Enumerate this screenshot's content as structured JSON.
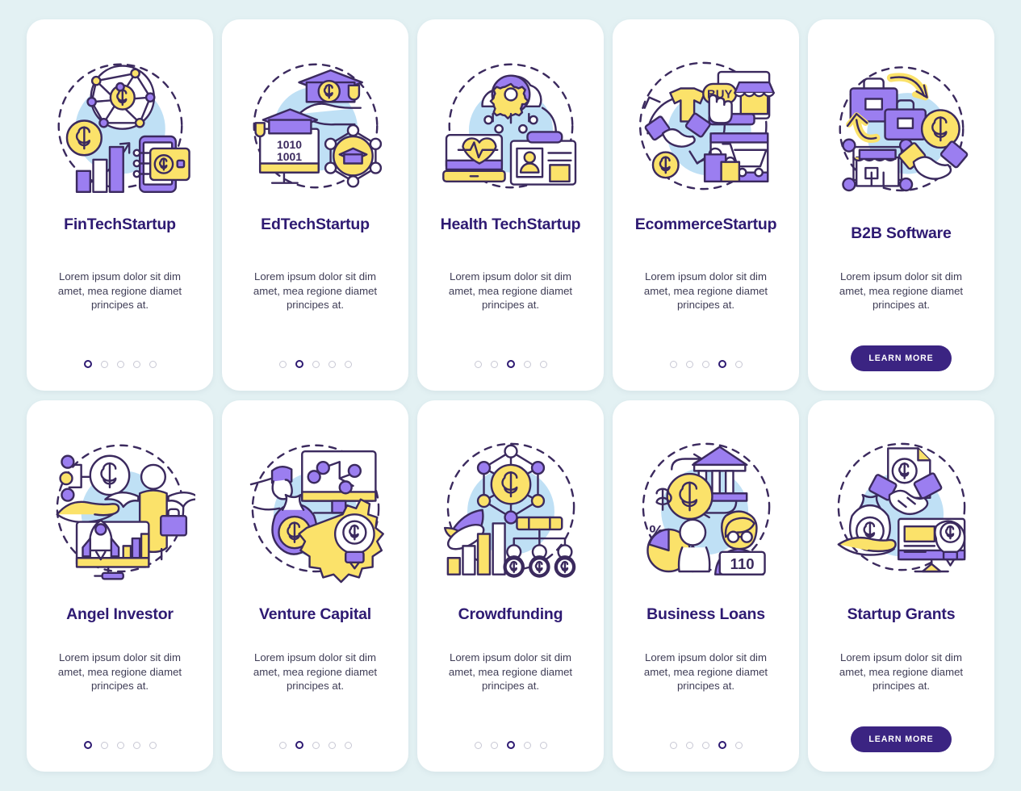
{
  "page": {
    "background_color": "#e3f1f3",
    "card_background": "#ffffff",
    "title_color": "#2e1a72",
    "body_color": "#3f3d56",
    "accent_purple": "#9b7ef0",
    "accent_yellow": "#fbe26a",
    "accent_blue": "#bfe0f5",
    "stroke_color": "#3b2a5e",
    "cta_color": "#3b2482",
    "dot_inactive_color": "#c8c8d4",
    "lorem": "Lorem ipsum dolor sit dim amet, mea regione diamet principes at."
  },
  "cards": [
    {
      "id": "fintech-startup",
      "title": "FinTech Startup",
      "title_lines": [
        "FinTech",
        "Startup"
      ],
      "description": "Lorem ipsum dolor sit dim amet, mea regione diamet principes at.",
      "footer_type": "dots",
      "dots_total": 5,
      "dots_active_index": 0,
      "illustration": "fintech-illustration",
      "illustration_labels": []
    },
    {
      "id": "edtech-startup",
      "title": "EdTech Startup",
      "title_lines": [
        "EdTech",
        "Startup"
      ],
      "description": "Lorem ipsum dolor sit dim amet, mea regione diamet principes at.",
      "footer_type": "dots",
      "dots_total": 5,
      "dots_active_index": 1,
      "illustration": "edtech-illustration",
      "illustration_labels": [
        "1010",
        "1001"
      ]
    },
    {
      "id": "health-tech-startup",
      "title": "Health Tech Startup",
      "title_lines": [
        "Health Tech",
        "Startup"
      ],
      "description": "Lorem ipsum dolor sit dim amet, mea regione diamet principes at.",
      "footer_type": "dots",
      "dots_total": 5,
      "dots_active_index": 2,
      "illustration": "healthtech-illustration",
      "illustration_labels": []
    },
    {
      "id": "ecommerce-startup",
      "title": "Ecommerce Startup",
      "title_lines": [
        "Ecommerce",
        "Startup"
      ],
      "description": "Lorem ipsum dolor sit dim amet, mea regione diamet principes at.",
      "footer_type": "dots",
      "dots_total": 5,
      "dots_active_index": 3,
      "illustration": "ecommerce-illustration",
      "illustration_labels": [
        "BUY"
      ]
    },
    {
      "id": "b2b-software",
      "title": "B2B Software",
      "title_lines": [
        "B2B Software"
      ],
      "description": "Lorem ipsum dolor sit dim amet, mea regione diamet principes at.",
      "footer_type": "button",
      "button_label": "LEARN MORE",
      "illustration": "b2b-illustration",
      "illustration_labels": []
    },
    {
      "id": "angel-investor",
      "title": "Angel Investor",
      "title_lines": [
        "Angel Investor"
      ],
      "description": "Lorem ipsum dolor sit dim amet, mea regione diamet principes at.",
      "footer_type": "dots",
      "dots_total": 5,
      "dots_active_index": 0,
      "illustration": "angel-investor-illustration",
      "illustration_labels": []
    },
    {
      "id": "venture-capital",
      "title": "Venture Capital",
      "title_lines": [
        "Venture Capital"
      ],
      "description": "Lorem ipsum dolor sit dim amet, mea regione diamet principes at.",
      "footer_type": "dots",
      "dots_total": 5,
      "dots_active_index": 1,
      "illustration": "venture-capital-illustration",
      "illustration_labels": []
    },
    {
      "id": "crowdfunding",
      "title": "Crowdfunding",
      "title_lines": [
        "Crowdfunding"
      ],
      "description": "Lorem ipsum dolor sit dim amet, mea regione diamet principes at.",
      "footer_type": "dots",
      "dots_total": 5,
      "dots_active_index": 2,
      "illustration": "crowdfunding-illustration",
      "illustration_labels": []
    },
    {
      "id": "business-loans",
      "title": "Business Loans",
      "title_lines": [
        "Business Loans"
      ],
      "description": "Lorem ipsum dolor sit dim amet, mea regione diamet principes at.",
      "footer_type": "dots",
      "dots_total": 5,
      "dots_active_index": 3,
      "illustration": "business-loans-illustration",
      "illustration_labels": [
        "110",
        "%"
      ]
    },
    {
      "id": "startup-grants",
      "title": "Startup Grants",
      "title_lines": [
        "Startup Grants"
      ],
      "description": "Lorem ipsum dolor sit dim amet, mea regione diamet principes at.",
      "footer_type": "button",
      "button_label": "LEARN MORE",
      "illustration": "startup-grants-illustration",
      "illustration_labels": []
    }
  ]
}
